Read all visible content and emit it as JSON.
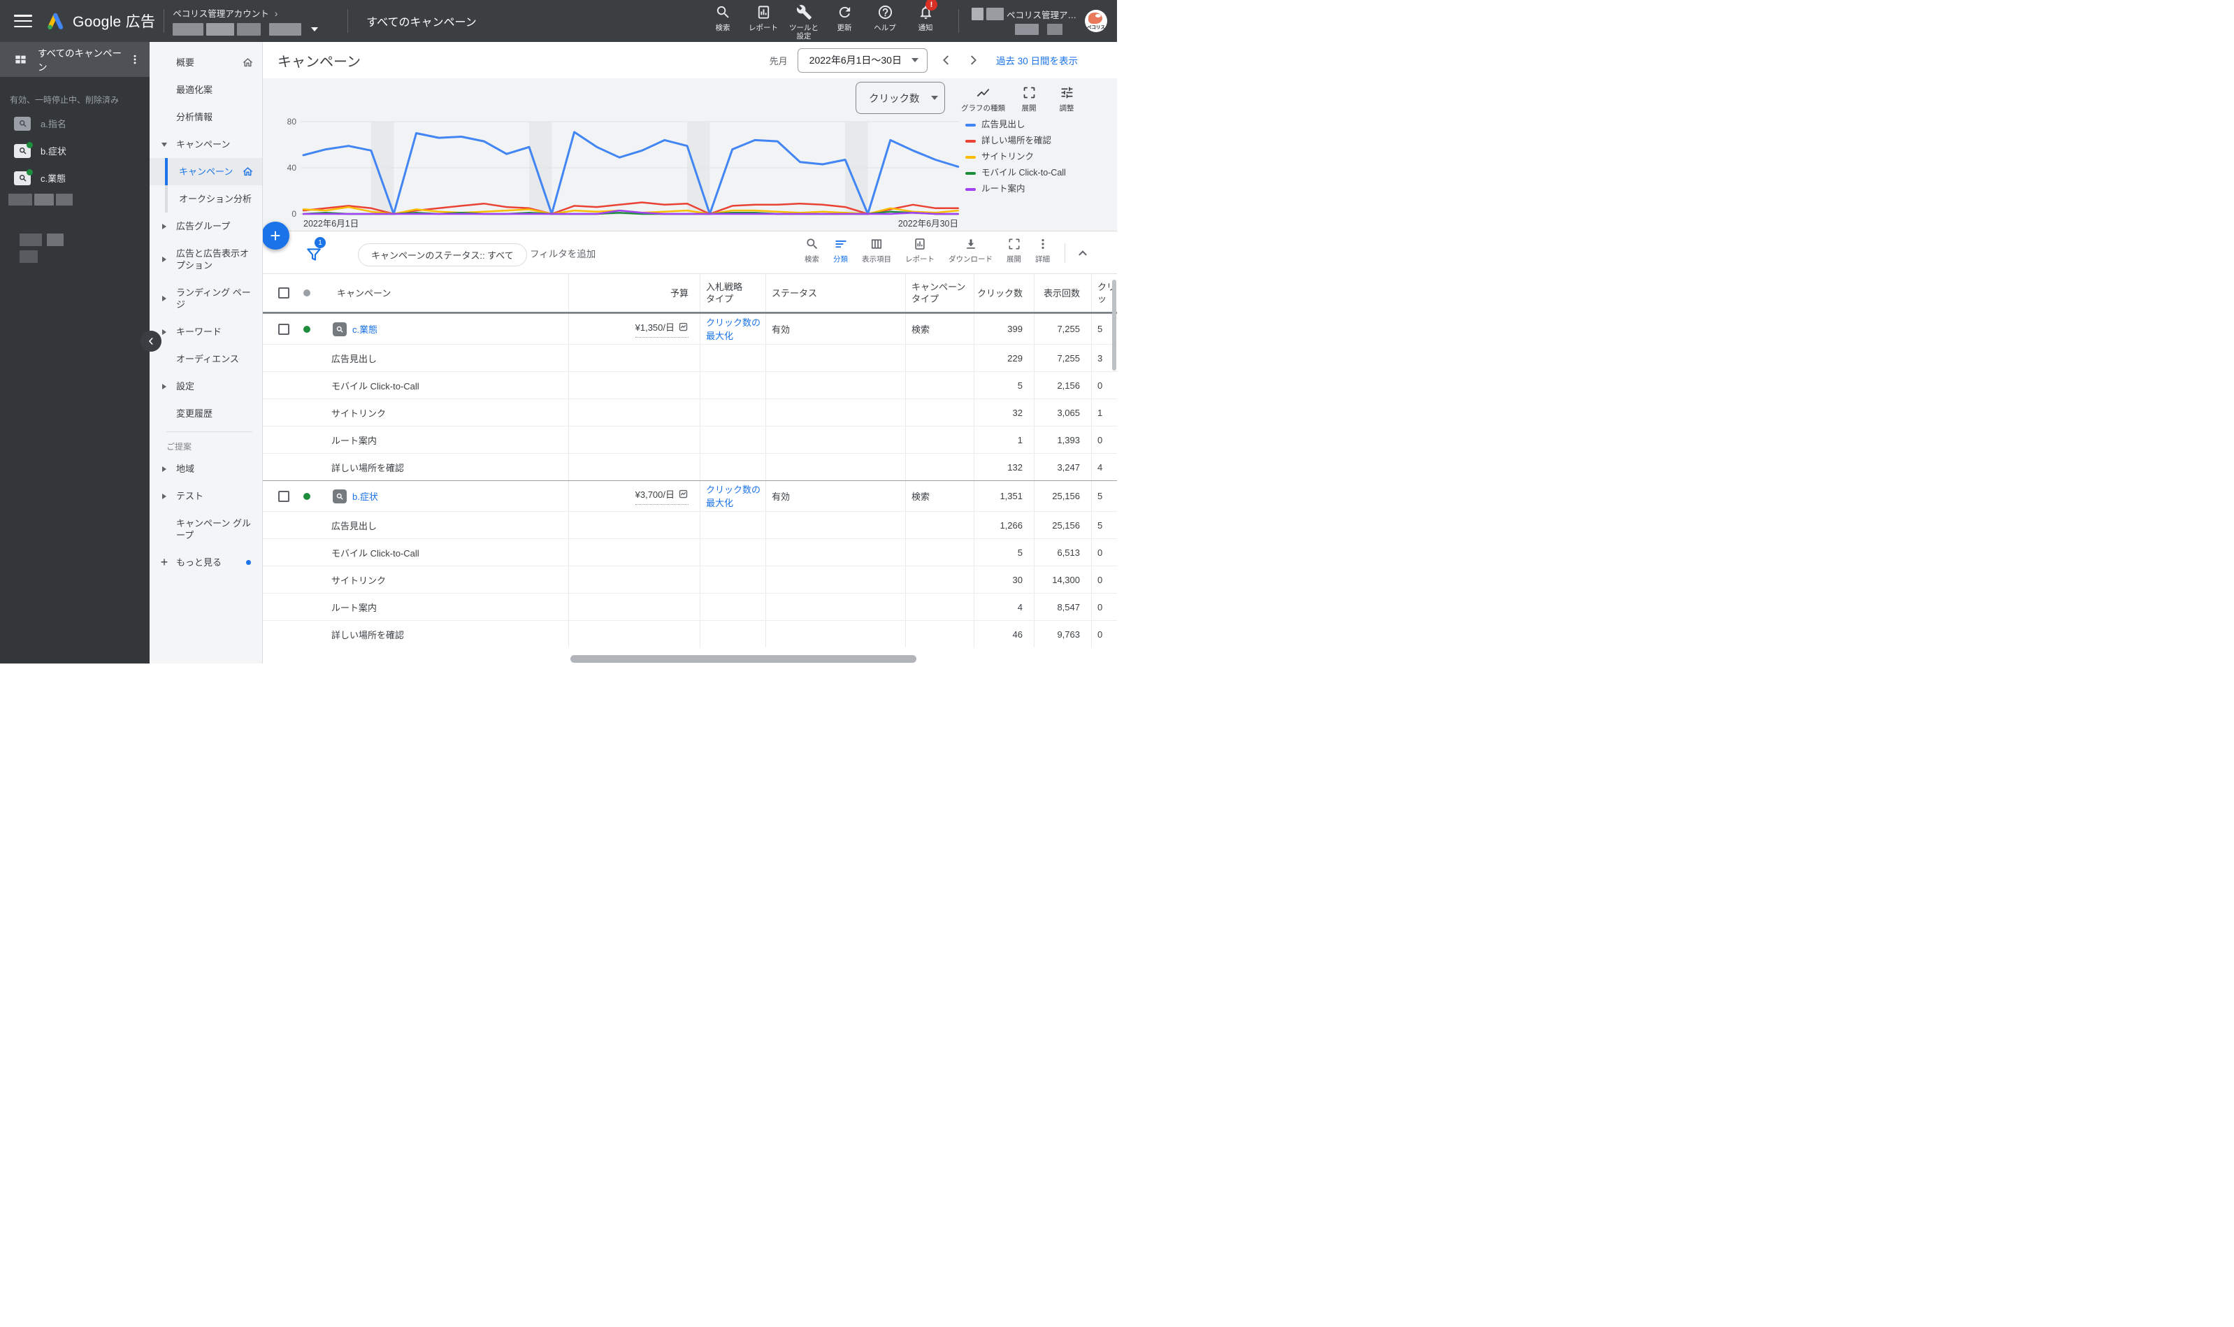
{
  "topbar": {
    "product": "Google 広告",
    "breadcrumb": "ペコリス管理アカウント",
    "context_title": "すべてのキャンペーン",
    "icon_buttons": [
      {
        "icon": "search",
        "label": "検索"
      },
      {
        "icon": "report",
        "label": "レポート"
      },
      {
        "icon": "tools",
        "label": "ツールと設定"
      },
      {
        "icon": "refresh",
        "label": "更新"
      },
      {
        "icon": "help",
        "label": "ヘルプ"
      },
      {
        "icon": "bell",
        "label": "通知",
        "badge": "!"
      }
    ],
    "account_name_truncated": "ペコリス管理ア…",
    "avatar_label": "ペコリス"
  },
  "sidebar": {
    "header": "すべてのキャンペーン",
    "filter_label": "有効、一時停止中、削除済み",
    "campaigns": [
      {
        "label": "a.指名",
        "active": false
      },
      {
        "label": "b.症状",
        "active": true
      },
      {
        "label": "c.業態",
        "active": true
      }
    ]
  },
  "drawer": {
    "items": [
      {
        "label": "概要",
        "home": true
      },
      {
        "label": "最適化案"
      },
      {
        "label": "分析情報"
      },
      {
        "label": "キャンペーン",
        "arrow": "down"
      },
      {
        "label": "キャンペーン",
        "sub": true,
        "selected": true,
        "home": true
      },
      {
        "label": "オークション分析",
        "sub": true
      },
      {
        "label": "広告グループ",
        "arrow": "right"
      },
      {
        "label": "広告と広告表示オプション",
        "arrow": "right",
        "two_line": true
      },
      {
        "label": "ランディング ページ",
        "arrow": "right",
        "two_line": true
      },
      {
        "label": "キーワード",
        "arrow": "right"
      },
      {
        "label": "オーディエンス"
      },
      {
        "label": "設定",
        "arrow": "right"
      },
      {
        "label": "変更履歴"
      },
      {
        "divider": true
      },
      {
        "label": "ご提案",
        "section": true
      },
      {
        "label": "地域",
        "arrow": "right"
      },
      {
        "label": "テスト",
        "arrow": "right"
      },
      {
        "label": "キャンペーン グループ",
        "two_line": true
      },
      {
        "label": "もっと見る",
        "plus": true,
        "dot": true
      }
    ]
  },
  "page_header": {
    "title": "キャンペーン",
    "date_preset": "先月",
    "date_range": "2022年6月1日～30日",
    "show_last_30": "過去 30 日間を表示"
  },
  "chart_panel": {
    "metric": "クリック数",
    "controls": [
      {
        "icon": "show-chart",
        "label": "グラフの種類"
      },
      {
        "icon": "expand",
        "label": "展開"
      },
      {
        "icon": "tune",
        "label": "調整"
      }
    ]
  },
  "chart_data": {
    "type": "line",
    "title": "クリック数",
    "x_start_label": "2022年6月1日",
    "x_end_label": "2022年6月30日",
    "x_days": 30,
    "ylim": [
      0,
      80
    ],
    "yticks": [
      0,
      40,
      80
    ],
    "weekend_bands": [
      [
        3,
        4
      ],
      [
        10,
        11
      ],
      [
        17,
        18
      ],
      [
        24,
        25
      ]
    ],
    "series": [
      {
        "name": "広告見出し",
        "color": "#4285f4",
        "values": [
          51,
          56,
          59,
          55,
          0,
          70,
          66,
          67,
          63,
          52,
          58,
          0,
          71,
          58,
          49,
          55,
          64,
          59,
          0,
          56,
          64,
          63,
          45,
          43,
          47,
          0,
          64,
          55,
          47,
          41
        ]
      },
      {
        "name": "詳しい場所を確認",
        "color": "#ea4335",
        "values": [
          3,
          5,
          7,
          5,
          0,
          3,
          5,
          7,
          9,
          6,
          5,
          0,
          7,
          6,
          8,
          10,
          8,
          9,
          0,
          7,
          8,
          8,
          9,
          8,
          6,
          0,
          4,
          8,
          5,
          5
        ]
      },
      {
        "name": "サイトリンク",
        "color": "#fbbc04",
        "values": [
          4,
          3,
          6,
          2,
          0,
          4,
          2,
          1,
          2,
          3,
          4,
          0,
          3,
          2,
          3,
          1,
          2,
          3,
          0,
          3,
          3,
          2,
          1,
          2,
          1,
          0,
          5,
          2,
          1,
          3
        ]
      },
      {
        "name": "モバイル Click-to-Call",
        "color": "#1e8e3e",
        "values": [
          0,
          1,
          0,
          0,
          0,
          1,
          0,
          1,
          0,
          0,
          1,
          0,
          0,
          0,
          1,
          0,
          0,
          0,
          0,
          1,
          1,
          0,
          0,
          0,
          0,
          0,
          2,
          1,
          0,
          0
        ]
      },
      {
        "name": "ルート案内",
        "color": "#a142f4",
        "values": [
          0,
          0,
          0,
          0,
          0,
          0,
          0,
          0,
          0,
          0,
          0,
          0,
          0,
          0,
          3,
          1,
          0,
          0,
          0,
          0,
          0,
          0,
          0,
          0,
          0,
          0,
          0,
          1,
          0,
          0
        ]
      }
    ]
  },
  "filter_bar": {
    "badge": "1",
    "chip": "キャンペーンのステータス:: すべて",
    "add_filter": "フィルタを追加"
  },
  "toolbar": {
    "items": [
      {
        "icon": "search",
        "label": "検索"
      },
      {
        "icon": "sort",
        "label": "分類",
        "active": true
      },
      {
        "icon": "columns",
        "label": "表示項目"
      },
      {
        "icon": "report",
        "label": "レポート"
      },
      {
        "icon": "download",
        "label": "ダウンロード"
      },
      {
        "icon": "expand",
        "label": "展開"
      },
      {
        "icon": "more",
        "label": "詳細"
      }
    ]
  },
  "table": {
    "columns": [
      "キャンペーン",
      "予算",
      "入札戦略タイプ",
      "ステータス",
      "キャンペーンタイプ",
      "クリック数",
      "表示回数",
      "クリッ"
    ],
    "rows": [
      {
        "type": "campaign",
        "name": "c.業態",
        "budget": "¥1,350/日",
        "bid_strategy": "クリック数の最大化",
        "status": "有効",
        "campaign_type": "検索",
        "clicks": "399",
        "impressions": "7,255",
        "last_partial": "5"
      },
      {
        "type": "asset",
        "name": "広告見出し",
        "clicks": "229",
        "impressions": "7,255",
        "last_partial": "3"
      },
      {
        "type": "asset",
        "name": "モバイル Click-to-Call",
        "clicks": "5",
        "impressions": "2,156",
        "last_partial": "0"
      },
      {
        "type": "asset",
        "name": "サイトリンク",
        "clicks": "32",
        "impressions": "3,065",
        "last_partial": "1"
      },
      {
        "type": "asset",
        "name": "ルート案内",
        "clicks": "1",
        "impressions": "1,393",
        "last_partial": "0"
      },
      {
        "type": "asset",
        "name": "詳しい場所を確認",
        "clicks": "132",
        "impressions": "3,247",
        "last_partial": "4"
      },
      {
        "type": "campaign",
        "name": "b.症状",
        "budget": "¥3,700/日",
        "bid_strategy": "クリック数の最大化",
        "status": "有効",
        "campaign_type": "検索",
        "clicks": "1,351",
        "impressions": "25,156",
        "last_partial": "5"
      },
      {
        "type": "asset",
        "name": "広告見出し",
        "clicks": "1,266",
        "impressions": "25,156",
        "last_partial": "5"
      },
      {
        "type": "asset",
        "name": "モバイル Click-to-Call",
        "clicks": "5",
        "impressions": "6,513",
        "last_partial": "0"
      },
      {
        "type": "asset",
        "name": "サイトリンク",
        "clicks": "30",
        "impressions": "14,300",
        "last_partial": "0"
      },
      {
        "type": "asset",
        "name": "ルート案内",
        "clicks": "4",
        "impressions": "8,547",
        "last_partial": "0"
      },
      {
        "type": "asset",
        "name": "詳しい場所を確認",
        "clicks": "46",
        "impressions": "9,763",
        "last_partial": "0"
      }
    ]
  }
}
